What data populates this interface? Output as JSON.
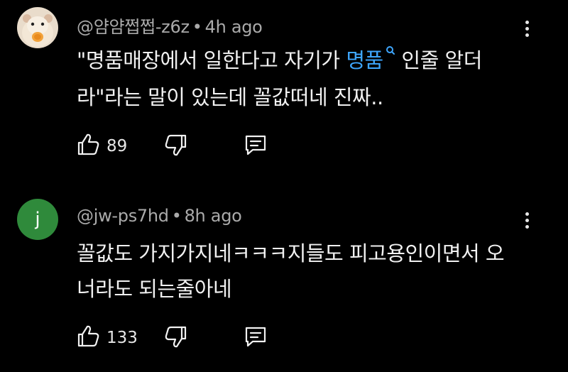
{
  "comments": [
    {
      "author": "@얌얌쩝쩝-z6z",
      "separator": "•",
      "time": "4h ago",
      "text_line1_before": "\"명품매장에서 일한다고 자기가 ",
      "text_link": "명품",
      "text_line1_after": " 인줄 알더",
      "text_line2": "라\"라는 말이 있는데 꼴값떠네 진짜..",
      "likes": "89",
      "avatar_icon": "hamster-avatar-icon"
    },
    {
      "author": "@jw-ps7hd",
      "separator": "•",
      "time": "8h ago",
      "avatar_letter": "j",
      "text_line1": "꼴값도 가지가지네ㅋㅋㅋ지들도 피고용인이면서 오",
      "text_line2": "너라도 되는줄아네",
      "likes": "133"
    }
  ],
  "colors": {
    "background": "#000000",
    "text": "#f1f1f1",
    "meta": "#aaaaaa",
    "link": "#3ea6ff",
    "avatar_green": "#2f8a3b"
  },
  "icons": [
    "like-icon",
    "dislike-icon",
    "reply-icon",
    "more-options-icon",
    "search-icon"
  ]
}
